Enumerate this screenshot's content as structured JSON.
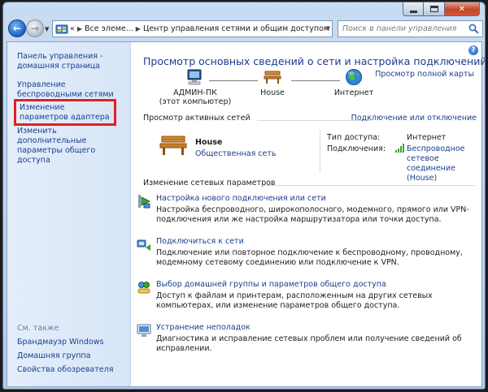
{
  "toolbar": {
    "address": {
      "overflow": "«",
      "crumb1": "Все элеме...",
      "crumb2": "Центр управления сетями и общим доступом"
    },
    "search_placeholder": "Поиск в панели управления"
  },
  "sidebar": {
    "items": [
      {
        "label": "Панель управления - домашняя страница"
      },
      {
        "label": "Управление беспроводными сетями"
      },
      {
        "label": "Изменение параметров адаптера"
      },
      {
        "label": "Изменить дополнительные параметры общего доступа"
      }
    ],
    "see_also": "См. также",
    "links": [
      {
        "label": "Брандмауэр Windows"
      },
      {
        "label": "Домашняя группа"
      },
      {
        "label": "Свойства обозревателя"
      }
    ]
  },
  "main": {
    "heading": "Просмотр основных сведений о сети и настройка подключений",
    "full_map_link": "Просмотр полной карты",
    "map": {
      "computer_name": "АДМИН-ПК",
      "computer_sub": "(этот компьютер)",
      "network": "House",
      "internet": "Интернет"
    },
    "active_networks": {
      "title": "Просмотр активных сетей",
      "connect_link": "Подключение или отключение",
      "network_name": "House",
      "network_type": "Общественная сеть",
      "access_type_label": "Тип доступа:",
      "access_type_value": "Интернет",
      "connections_label": "Подключения:",
      "connection_line1": "Беспроводное сетевое",
      "connection_line2": "соединение (House)"
    },
    "change_settings": {
      "title": "Изменение сетевых параметров",
      "tasks": [
        {
          "title": "Настройка нового подключения или сети",
          "desc": "Настройка беспроводного, широкополосного, модемного, прямого или VPN-подключения или же настройка маршрутизатора или точки доступа."
        },
        {
          "title": "Подключиться к сети",
          "desc": "Подключение или повторное подключение к беспроводному, проводному, модемному сетевому соединению или подключение к VPN."
        },
        {
          "title": "Выбор домашней группы и параметров общего доступа",
          "desc": "Доступ к файлам и принтерам, расположенным на других сетевых компьютерах, или изменение параметров общего доступа."
        },
        {
          "title": "Устранение неполадок",
          "desc": "Диагностика и исправление сетевых проблем или получение сведений об исправлении."
        }
      ]
    }
  },
  "colors": {
    "link": "#1a3f8a",
    "heading": "#1e3a8f",
    "highlight_box": "#e02020"
  }
}
